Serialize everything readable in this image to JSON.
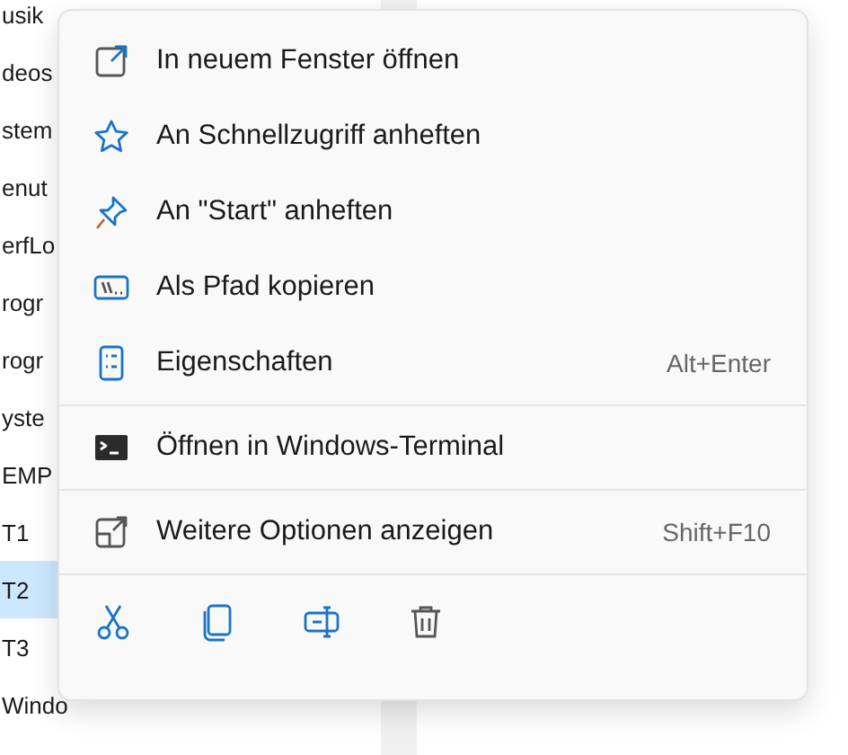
{
  "file_list": [
    {
      "name": "usik",
      "selected": false
    },
    {
      "name": "deos",
      "selected": false
    },
    {
      "name": "stem",
      "selected": false
    },
    {
      "name": "enut",
      "selected": false
    },
    {
      "name": "erfLo",
      "selected": false
    },
    {
      "name": "rogr",
      "selected": false
    },
    {
      "name": "rogr",
      "selected": false
    },
    {
      "name": "yste",
      "selected": false
    },
    {
      "name": "EMP",
      "selected": false
    },
    {
      "name": "T1",
      "selected": false
    },
    {
      "name": "T2",
      "selected": true
    },
    {
      "name": "T3",
      "selected": false
    },
    {
      "name": "Windo",
      "selected": false
    }
  ],
  "context_menu": {
    "sections": [
      [
        {
          "label": "In neuem Fenster öffnen"
        },
        {
          "label": "An Schnellzugriff anheften"
        },
        {
          "label": "An \"Start\" anheften"
        },
        {
          "label": "Als Pfad kopieren"
        },
        {
          "label": "Eigenschaften",
          "shortcut": "Alt+Enter"
        }
      ],
      [
        {
          "label": "Öffnen in Windows-Terminal"
        }
      ],
      [
        {
          "label": "Weitere Optionen anzeigen",
          "shortcut": "Shift+F10"
        }
      ]
    ]
  }
}
